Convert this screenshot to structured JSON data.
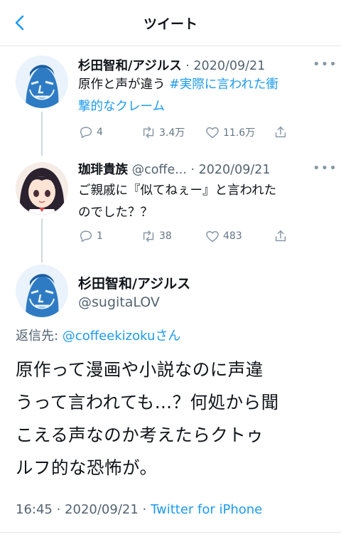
{
  "header": {
    "title": "ツイート"
  },
  "tweets": [
    {
      "name": "杉田智和/アジルス",
      "handle": "",
      "date": "2020/09/21",
      "text_plain": "原作と声が違う ",
      "hashtag_line1": "#実際に言われた衝",
      "hashtag_line2": "撃的なクレーム",
      "replies": "4",
      "retweets": "3.4万",
      "likes": "11.6万"
    },
    {
      "name": "珈琲貴族",
      "handle": "@coffe...",
      "date": "2020/09/21",
      "text_line1": "ご親戚に『似てねぇー』と言われた",
      "text_line2": "のでした？？",
      "replies": "1",
      "retweets": "38",
      "likes": "483"
    }
  ],
  "focus": {
    "name": "杉田智和/アジルス",
    "handle": "@sugitaLOV",
    "reply_prefix": "返信先: ",
    "reply_mention": "@coffeekizoku",
    "reply_suffix": "さん",
    "text_lines": [
      "原作って漫画や小説なのに声違",
      "うって言われても…？何処から聞",
      "こえる声なのか考えたらクトゥ",
      "ルフ的な恐怖が。"
    ],
    "time": "16:45",
    "date": "2020/09/21",
    "client": "Twitter for iPhone"
  },
  "colors": {
    "accent": "#1d9bf0",
    "secondary_text": "#536471"
  }
}
